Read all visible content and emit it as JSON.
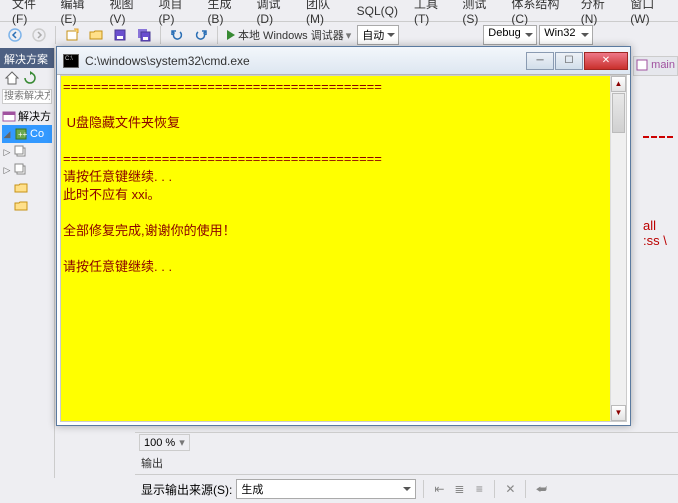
{
  "menu": {
    "file": "文件(F)",
    "edit": "编辑(E)",
    "view": "视图(V)",
    "project": "项目(P)",
    "build": "生成(B)",
    "debug": "调试(D)",
    "team": "团队(M)",
    "sql": "SQL(Q)",
    "tools": "工具(T)",
    "test": "测试(S)",
    "arch": "体系结构(C)",
    "analyze": "分析(N)",
    "window": "窗口(W)"
  },
  "toolbar": {
    "debugger_label": "本地 Windows 调试器",
    "auto": "自动",
    "config": "Debug",
    "platform": "Win32"
  },
  "sidepanel": {
    "title": "解决方案资",
    "search_ph": "搜索解决方案",
    "solution_label": "解决方",
    "project_label": "Co"
  },
  "cmd": {
    "title": "C:\\windows\\system32\\cmd.exe",
    "divider": "==========================================",
    "heading": "U盘隐藏文件夹恢复",
    "press_key": "请按任意键继续. . .",
    "no_xxi": "此时不应有 xxi。",
    "done": "全部修复完成,谢谢你的使用！",
    "press_key2": "请按任意键继续. . ."
  },
  "right": {
    "main_tab": "main",
    "error_text": "all :ss \\"
  },
  "bottom": {
    "zoom": "100 %",
    "output_title": "输出",
    "show_from": "显示输出来源(S):",
    "source": "生成"
  },
  "chart_data": null
}
